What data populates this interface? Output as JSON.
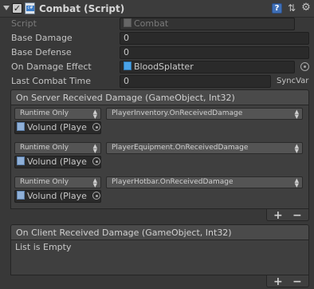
{
  "header": {
    "title": "Combat (Script)",
    "enabled": true,
    "help_glyph": "?",
    "settings_glyph": "⇅",
    "gear_glyph": "⚙"
  },
  "properties": {
    "script": {
      "label": "Script",
      "value": "Combat"
    },
    "base_damage": {
      "label": "Base Damage",
      "value": "0"
    },
    "base_defense": {
      "label": "Base Defense",
      "value": "0"
    },
    "on_damage_effect": {
      "label": "On Damage Effect",
      "value": "BloodSplatter"
    },
    "last_combat_time": {
      "label": "Last Combat Time",
      "value": "0",
      "tag": "SyncVar"
    }
  },
  "server_event": {
    "title": "On Server Received Damage (GameObject, Int32)",
    "entries": [
      {
        "mode": "Runtime Only",
        "target": "Volund (Playe",
        "function": "PlayerInventory.OnReceivedDamage"
      },
      {
        "mode": "Runtime Only",
        "target": "Volund (Playe",
        "function": "PlayerEquipment.OnReceivedDamage"
      },
      {
        "mode": "Runtime Only",
        "target": "Volund (Playe",
        "function": "PlayerHotbar.OnReceivedDamage"
      }
    ],
    "add_label": "+",
    "remove_label": "−"
  },
  "client_event": {
    "title": "On Client Received Damage (GameObject, Int32)",
    "empty_text": "List is Empty",
    "add_label": "+",
    "remove_label": "−"
  },
  "colors": {
    "background": "#383838",
    "help_icon": "#3f6fb6",
    "prefab_cube": "#4aa3e8"
  }
}
